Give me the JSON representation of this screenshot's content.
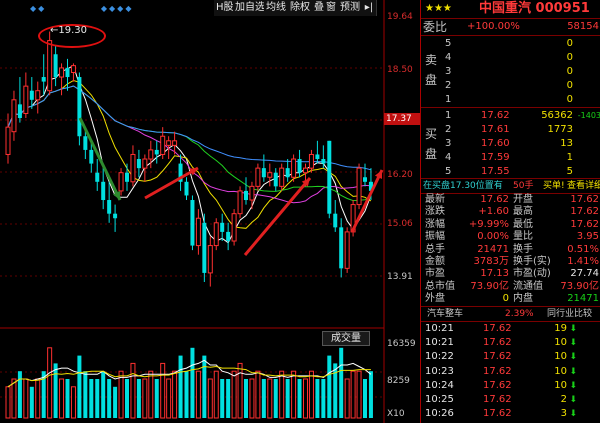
{
  "toolbar": {
    "tabs": [
      "H股",
      "加自选",
      "均线",
      "除权",
      "叠",
      "窗",
      "预测"
    ]
  },
  "chart": {
    "annotation_high": "19.30",
    "price_axis": [
      "19.64",
      "18.50",
      "17.37",
      "16.20",
      "15.06",
      "13.91"
    ],
    "current_price_tag": "17.37",
    "volume_button": "成交量",
    "volume_axis": [
      "16359",
      "8259",
      "X10"
    ],
    "candles": [
      {
        "o": 16.6,
        "h": 17.5,
        "l": 16.4,
        "c": 17.2
      },
      {
        "o": 17.1,
        "h": 18.0,
        "l": 16.9,
        "c": 17.8
      },
      {
        "o": 17.7,
        "h": 18.3,
        "l": 17.3,
        "c": 17.4
      },
      {
        "o": 17.5,
        "h": 18.4,
        "l": 17.4,
        "c": 18.1
      },
      {
        "o": 18.0,
        "h": 18.3,
        "l": 17.6,
        "c": 17.8
      },
      {
        "o": 17.8,
        "h": 18.2,
        "l": 17.5,
        "c": 18.0
      },
      {
        "o": 18.3,
        "h": 18.8,
        "l": 17.9,
        "c": 18.2
      },
      {
        "o": 18.0,
        "h": 19.3,
        "l": 17.9,
        "c": 19.1
      },
      {
        "o": 18.8,
        "h": 19.0,
        "l": 18.1,
        "c": 18.3
      },
      {
        "o": 18.3,
        "h": 18.6,
        "l": 17.9,
        "c": 18.5
      },
      {
        "o": 18.5,
        "h": 18.7,
        "l": 18.0,
        "c": 18.3
      },
      {
        "o": 18.4,
        "h": 18.6,
        "l": 18.2,
        "c": 18.55
      },
      {
        "o": 18.3,
        "h": 18.4,
        "l": 16.8,
        "c": 17.0
      },
      {
        "o": 17.0,
        "h": 17.2,
        "l": 16.5,
        "c": 16.7
      },
      {
        "o": 16.7,
        "h": 16.9,
        "l": 16.2,
        "c": 16.4
      },
      {
        "o": 16.2,
        "h": 16.5,
        "l": 15.8,
        "c": 16.0
      },
      {
        "o": 16.0,
        "h": 16.4,
        "l": 15.4,
        "c": 15.6
      },
      {
        "o": 15.6,
        "h": 16.0,
        "l": 15.1,
        "c": 15.3
      },
      {
        "o": 15.3,
        "h": 15.5,
        "l": 14.9,
        "c": 15.2
      },
      {
        "o": 15.8,
        "h": 16.3,
        "l": 15.7,
        "c": 16.2
      },
      {
        "o": 16.2,
        "h": 16.4,
        "l": 15.8,
        "c": 16.0
      },
      {
        "o": 16.0,
        "h": 16.8,
        "l": 15.9,
        "c": 16.6
      },
      {
        "o": 16.5,
        "h": 16.7,
        "l": 16.1,
        "c": 16.3
      },
      {
        "o": 16.3,
        "h": 16.6,
        "l": 16.0,
        "c": 16.5
      },
      {
        "o": 16.5,
        "h": 16.9,
        "l": 16.3,
        "c": 16.7
      },
      {
        "o": 16.7,
        "h": 16.9,
        "l": 16.4,
        "c": 16.6
      },
      {
        "o": 16.6,
        "h": 17.2,
        "l": 16.5,
        "c": 17.0
      },
      {
        "o": 16.8,
        "h": 17.0,
        "l": 16.5,
        "c": 16.9
      },
      {
        "o": 16.8,
        "h": 17.1,
        "l": 16.6,
        "c": 16.9
      },
      {
        "o": 16.4,
        "h": 16.6,
        "l": 15.8,
        "c": 16.0
      },
      {
        "o": 16.0,
        "h": 16.1,
        "l": 15.6,
        "c": 15.7
      },
      {
        "o": 15.6,
        "h": 15.7,
        "l": 14.5,
        "c": 14.6
      },
      {
        "o": 14.6,
        "h": 15.4,
        "l": 14.4,
        "c": 15.2
      },
      {
        "o": 15.1,
        "h": 15.3,
        "l": 13.8,
        "c": 14.0
      },
      {
        "o": 14.0,
        "h": 14.8,
        "l": 13.7,
        "c": 14.6
      },
      {
        "o": 14.6,
        "h": 15.2,
        "l": 14.5,
        "c": 15.1
      },
      {
        "o": 15.1,
        "h": 15.3,
        "l": 14.7,
        "c": 14.9
      },
      {
        "o": 14.9,
        "h": 15.1,
        "l": 14.5,
        "c": 14.7
      },
      {
        "o": 14.7,
        "h": 15.4,
        "l": 14.6,
        "c": 15.3
      },
      {
        "o": 15.3,
        "h": 15.9,
        "l": 15.2,
        "c": 15.8
      },
      {
        "o": 15.8,
        "h": 16.1,
        "l": 15.5,
        "c": 15.6
      },
      {
        "o": 15.6,
        "h": 16.0,
        "l": 15.4,
        "c": 15.9
      },
      {
        "o": 15.9,
        "h": 16.4,
        "l": 15.8,
        "c": 16.3
      },
      {
        "o": 16.3,
        "h": 16.6,
        "l": 16.0,
        "c": 16.1
      },
      {
        "o": 16.1,
        "h": 16.4,
        "l": 15.9,
        "c": 16.2
      },
      {
        "o": 16.2,
        "h": 16.3,
        "l": 15.8,
        "c": 15.9
      },
      {
        "o": 15.9,
        "h": 16.4,
        "l": 15.8,
        "c": 16.3
      },
      {
        "o": 16.3,
        "h": 16.5,
        "l": 16.0,
        "c": 16.1
      },
      {
        "o": 16.1,
        "h": 16.6,
        "l": 16.0,
        "c": 16.5
      },
      {
        "o": 16.5,
        "h": 16.7,
        "l": 16.1,
        "c": 16.2
      },
      {
        "o": 16.2,
        "h": 16.4,
        "l": 15.9,
        "c": 16.3
      },
      {
        "o": 16.3,
        "h": 16.7,
        "l": 16.2,
        "c": 16.6
      },
      {
        "o": 16.6,
        "h": 16.9,
        "l": 16.4,
        "c": 16.5
      },
      {
        "o": 16.5,
        "h": 16.8,
        "l": 16.3,
        "c": 16.4
      },
      {
        "o": 16.9,
        "h": 16.9,
        "l": 15.2,
        "c": 15.3
      },
      {
        "o": 15.3,
        "h": 15.6,
        "l": 14.9,
        "c": 15.0
      },
      {
        "o": 15.0,
        "h": 15.2,
        "l": 13.9,
        "c": 14.1
      },
      {
        "o": 14.1,
        "h": 15.0,
        "l": 14.0,
        "c": 14.9
      },
      {
        "o": 14.9,
        "h": 15.6,
        "l": 14.8,
        "c": 15.5
      },
      {
        "o": 15.5,
        "h": 16.4,
        "l": 15.4,
        "c": 16.3
      },
      {
        "o": 16.1,
        "h": 16.4,
        "l": 15.9,
        "c": 16.0
      },
      {
        "o": 16.0,
        "h": 16.3,
        "l": 15.6,
        "c": 15.8
      }
    ],
    "volumes": [
      4,
      5,
      6,
      5,
      4,
      5,
      6,
      9,
      7,
      5,
      5,
      4,
      8,
      6,
      5,
      5,
      6,
      5,
      4,
      6,
      5,
      7,
      5,
      5,
      6,
      5,
      7,
      5,
      6,
      8,
      6,
      9,
      6,
      8,
      5,
      6,
      5,
      5,
      6,
      7,
      5,
      5,
      6,
      5,
      5,
      5,
      6,
      5,
      6,
      5,
      5,
      6,
      5,
      5,
      8,
      7,
      9,
      5,
      6,
      6,
      5,
      6
    ]
  },
  "quote": {
    "stars": "★★★",
    "title": "中国重汽 000951",
    "weibi_label": "委比",
    "weibi_pct": "+100.00%",
    "weibi_val": "58154",
    "sell_side_label": [
      "卖",
      "盘"
    ],
    "buy_side_label": [
      "买",
      "盘"
    ],
    "sell": [
      {
        "n": "5",
        "p": "",
        "v": "0"
      },
      {
        "n": "4",
        "p": "",
        "v": "0"
      },
      {
        "n": "3",
        "p": "",
        "v": "0"
      },
      {
        "n": "2",
        "p": "",
        "v": "0"
      },
      {
        "n": "1",
        "p": "",
        "v": "0"
      }
    ],
    "buy": [
      {
        "n": "1",
        "p": "17.62",
        "v": "56362",
        "d": "-1403"
      },
      {
        "n": "2",
        "p": "17.61",
        "v": "1773",
        "d": ""
      },
      {
        "n": "3",
        "p": "17.60",
        "v": "13",
        "d": ""
      },
      {
        "n": "4",
        "p": "17.59",
        "v": "1",
        "d": ""
      },
      {
        "n": "5",
        "p": "17.55",
        "v": "5",
        "d": ""
      }
    ],
    "pos_line": "在买盘17.30位置有",
    "pos_hand": "50手",
    "pos_link": "买单!",
    "pos_detail": "查看详细",
    "stats": [
      {
        "l1": "最新",
        "v1": "17.62",
        "l2": "开盘",
        "v2": "17.62"
      },
      {
        "l1": "涨跌",
        "v1": "+1.60",
        "l2": "最高",
        "v2": "17.62"
      },
      {
        "l1": "涨幅",
        "v1": "+9.99%",
        "l2": "最低",
        "v2": "17.62"
      },
      {
        "l1": "振幅",
        "v1": "0.00%",
        "l2": "量比",
        "v2": "3.95"
      },
      {
        "l1": "总手",
        "v1": "21471",
        "l2": "换手",
        "v2": "0.51%"
      },
      {
        "l1": "金额",
        "v1": "3783万",
        "l2": "换手(实)",
        "v2": "1.41%"
      },
      {
        "l1": "市盈",
        "v1": "17.13",
        "l2": "市盈(动)",
        "v2": "27.74"
      },
      {
        "l1": "总市值",
        "v1": "73.90亿",
        "l2": "流通值",
        "v2": "73.90亿"
      },
      {
        "l1": "外盘",
        "v1": "0",
        "l2": "内盘",
        "v2": "21471"
      }
    ],
    "sector": "汽车整车",
    "sector_pct": "2.39%",
    "peer": "同行业比较",
    "ticks": [
      {
        "t": "10:21",
        "p": "17.62",
        "v": "19"
      },
      {
        "t": "10:21",
        "p": "17.62",
        "v": "10"
      },
      {
        "t": "10:22",
        "p": "17.62",
        "v": "10"
      },
      {
        "t": "10:23",
        "p": "17.62",
        "v": "10"
      },
      {
        "t": "10:24",
        "p": "17.62",
        "v": "10"
      },
      {
        "t": "10:25",
        "p": "17.62",
        "v": "2"
      },
      {
        "t": "10:26",
        "p": "17.62",
        "v": "3"
      }
    ]
  }
}
